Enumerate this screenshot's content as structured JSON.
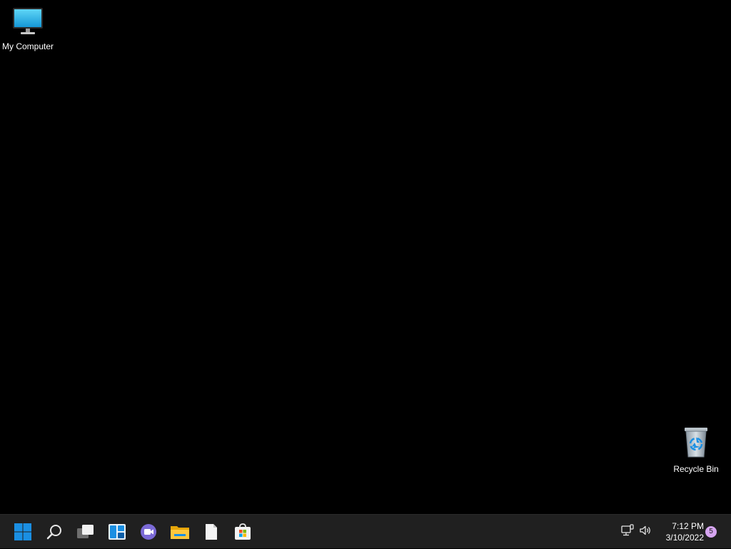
{
  "desktop": {
    "icons": [
      {
        "label": "My Computer",
        "icon": "monitor-icon"
      },
      {
        "label": "Recycle Bin",
        "icon": "recycle-bin-icon"
      }
    ]
  },
  "taskbar": {
    "buttons": [
      {
        "icon": "windows-start-icon"
      },
      {
        "icon": "search-icon"
      },
      {
        "icon": "task-view-icon"
      },
      {
        "icon": "widgets-icon"
      },
      {
        "icon": "teams-chat-icon"
      },
      {
        "icon": "file-explorer-icon"
      },
      {
        "icon": "notepad-file-icon"
      },
      {
        "icon": "microsoft-store-icon"
      }
    ],
    "tray": {
      "network_icon": "network-icon",
      "volume_icon": "volume-icon",
      "time": "7:12 PM",
      "date": "3/10/2022",
      "notification_count": "5"
    }
  },
  "colors": {
    "desktop_background": "#000000",
    "taskbar_background": "#202020",
    "accent_blue": "#1a8fe3",
    "badge": "#d6a5f0"
  }
}
